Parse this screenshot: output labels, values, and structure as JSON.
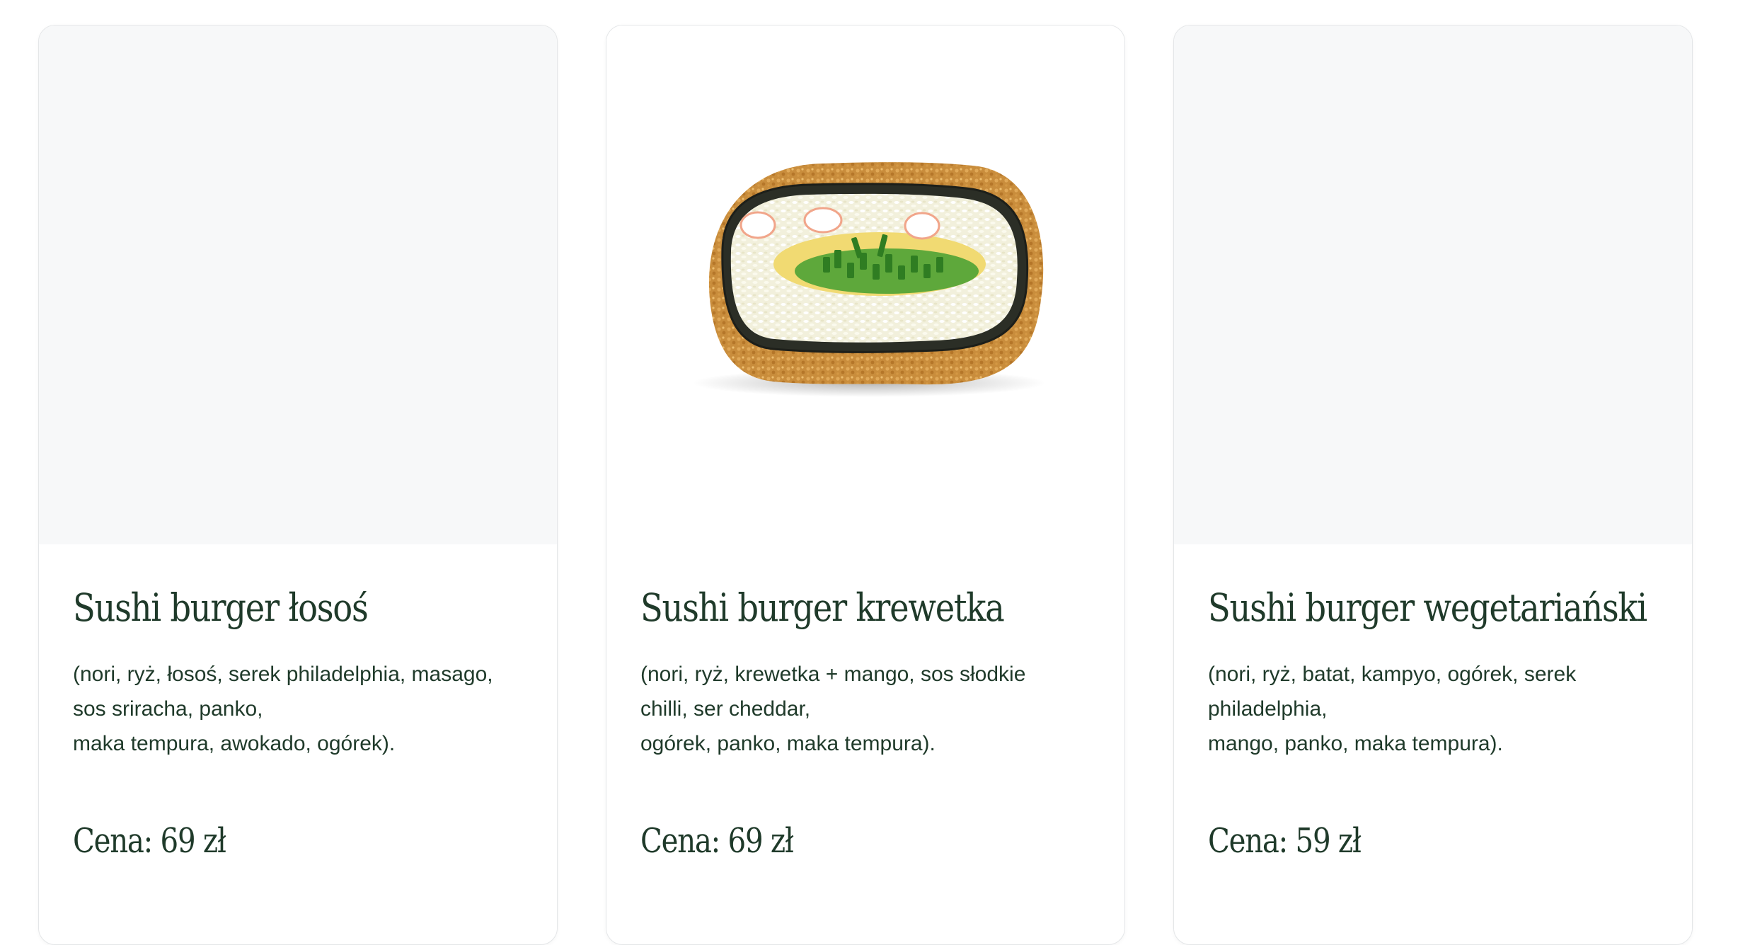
{
  "cards": [
    {
      "title": "Sushi burger łosoś",
      "description": "(nori, ryż, łosoś, serek philadelphia, masago,\nsos sriracha, panko,\nmaka tempura, awokado, ogórek).",
      "price": "Cena: 69 zł",
      "has_image": false
    },
    {
      "title": "Sushi burger krewetka",
      "description": "(nori, ryż, krewetka + mango, sos słodkie\nchilli, ser cheddar,\nogórek, panko, maka tempura).",
      "price": "Cena: 69 zł",
      "has_image": true,
      "image_icon": "sushi-burger-photo"
    },
    {
      "title": "Sushi burger wegetariański",
      "description": "(nori, ryż, batat, kampyo, ogórek, serek\nphiladelphia,\nmango, panko, maka tempura).",
      "price": "Cena: 59 zł",
      "has_image": false
    }
  ],
  "colors": {
    "text": "#1f3a2a",
    "placeholder": "#f7f8f9",
    "border": "#e4e6e8"
  }
}
